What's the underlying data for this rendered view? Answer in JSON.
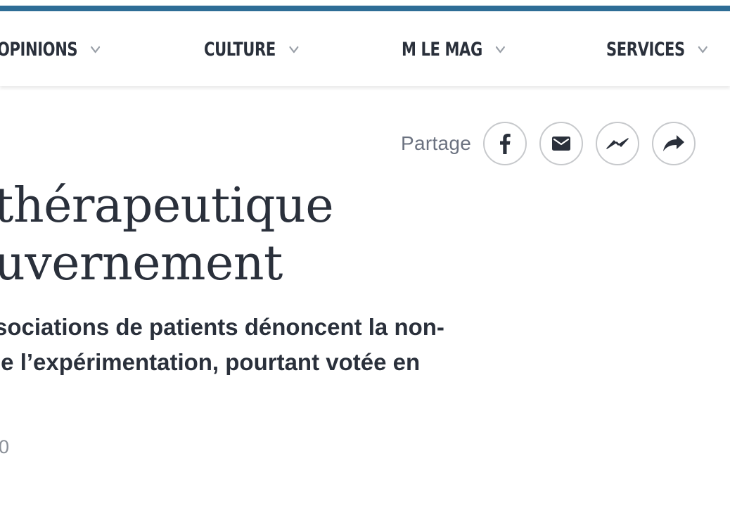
{
  "colors": {
    "accent_bar": "#2e6d96",
    "text": "#2a303b",
    "muted": "#6b7280",
    "circle_border": "#c7c9cc"
  },
  "nav": {
    "items": [
      {
        "label": "OPINIONS",
        "icon": "chevron-down-icon"
      },
      {
        "label": "CULTURE",
        "icon": "chevron-down-icon"
      },
      {
        "label": "M LE MAG",
        "icon": "chevron-down-icon"
      },
      {
        "label": "SERVICES",
        "icon": "chevron-down-icon"
      }
    ]
  },
  "share": {
    "label": "Partage",
    "buttons": [
      {
        "icon": "facebook-icon"
      },
      {
        "icon": "mail-icon"
      },
      {
        "icon": "messenger-icon"
      },
      {
        "icon": "share-arrow-icon"
      }
    ]
  },
  "article": {
    "title_lines": [
      " thérapeutique",
      "uvernement"
    ],
    "subtitle_lines": [
      "sociations de patients dénoncent la non-",
      "le l’expérimentation, pourtant votée en"
    ],
    "date_fragment": "0"
  }
}
